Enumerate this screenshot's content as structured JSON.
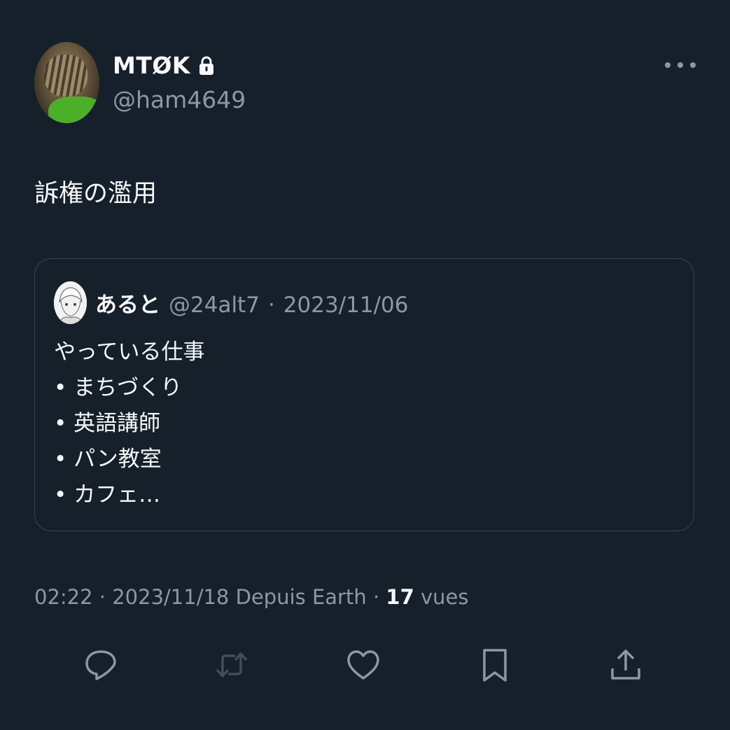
{
  "author": {
    "display_name": "MTØK",
    "handle": "@ham4649",
    "protected": true,
    "avatar": "cat-photo"
  },
  "tweet": {
    "text": "訴権の濫用"
  },
  "quoted_tweet": {
    "display_name": "あると",
    "handle": "@24alt7",
    "separator": "·",
    "date": "2023/11/06",
    "lines": [
      "やっている仕事",
      "• まちづくり",
      "• 英語講師",
      "• パン教室",
      "• カフェ…"
    ]
  },
  "meta": {
    "time": "02:22",
    "sep1": "·",
    "date": "2023/11/18",
    "source": "Depuis Earth",
    "sep2": "·",
    "views_count": "17",
    "views_label": "vues"
  },
  "actions": {
    "reply": "reply-icon",
    "retweet": "retweet-icon",
    "like": "heart-icon",
    "bookmark": "bookmark-icon",
    "share": "share-icon"
  },
  "colors": {
    "background": "#15202b",
    "text": "#f7f9f9",
    "secondary": "#8b98a5",
    "border": "#38444d",
    "retweet_disabled": "#3d4f5c"
  }
}
